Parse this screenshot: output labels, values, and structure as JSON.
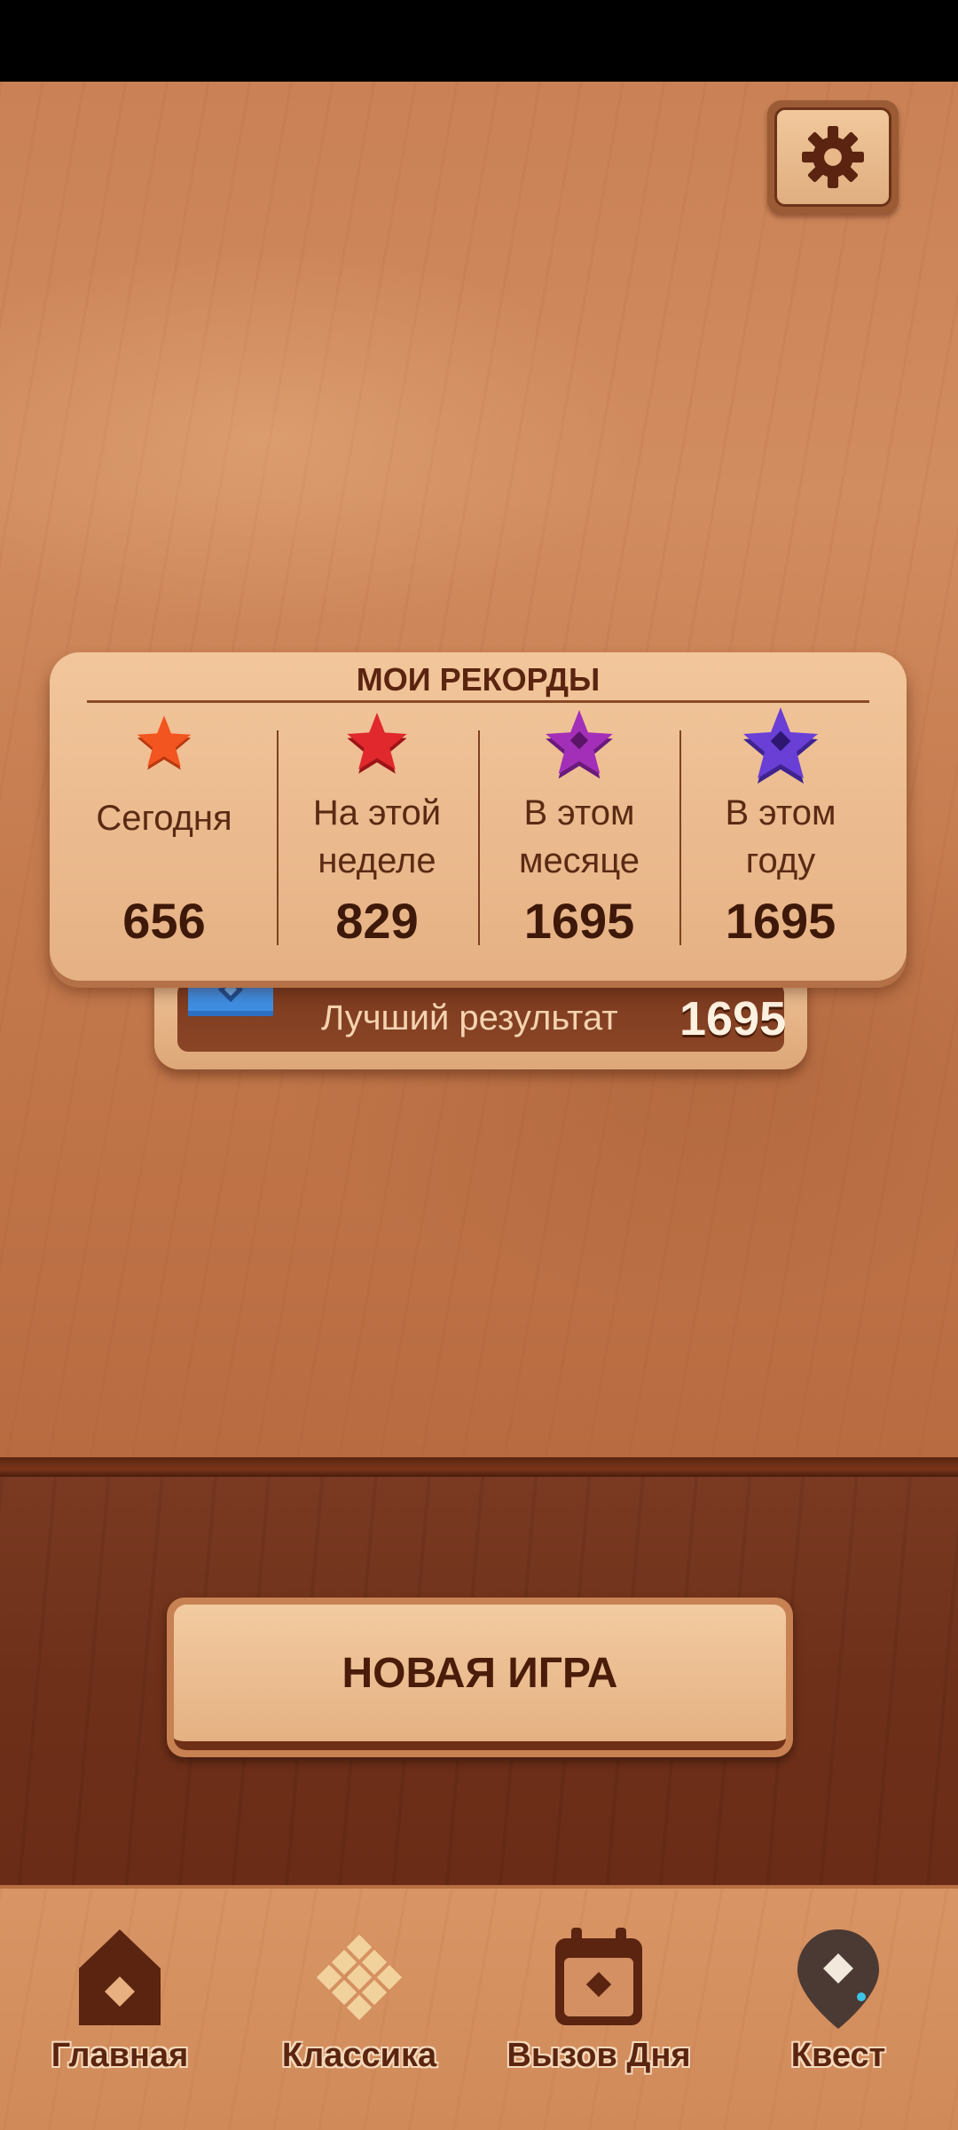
{
  "settings": {
    "icon": "gear-icon"
  },
  "records": {
    "title": "МОИ РЕКОРДЫ",
    "columns": [
      {
        "label_line1": "Сегодня",
        "label_line2": "",
        "value": "656",
        "star_color": "#f2551f",
        "icon": "star-orange-icon"
      },
      {
        "label_line1": "На этой",
        "label_line2": "неделе",
        "value": "829",
        "star_color": "#e0282d",
        "icon": "star-red-icon"
      },
      {
        "label_line1": "В этом",
        "label_line2": "месяце",
        "value": "1695",
        "star_color": "#a32fb8",
        "icon": "star-purple-icon"
      },
      {
        "label_line1": "В этом",
        "label_line2": "году",
        "value": "1695",
        "star_color": "#6a3fd6",
        "icon": "star-violet-icon"
      }
    ]
  },
  "best": {
    "label": "Лучший результат",
    "value": "1695",
    "icon": "crown-icon",
    "crown_color": "#3b82d9"
  },
  "new_game": {
    "label": "НОВАЯ ИГРА"
  },
  "nav": {
    "items": [
      {
        "label": "Главная",
        "icon": "home-icon"
      },
      {
        "label": "Классика",
        "icon": "classic-diamond-icon"
      },
      {
        "label": "Вызов Дня",
        "icon": "calendar-icon"
      },
      {
        "label": "Квест",
        "icon": "map-pin-icon"
      }
    ]
  }
}
